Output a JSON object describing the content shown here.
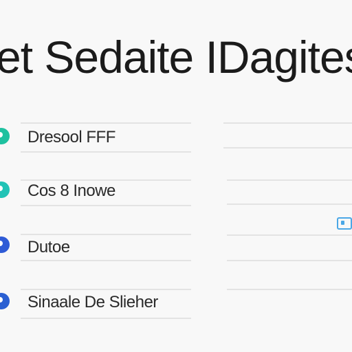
{
  "header": {
    "title": "et Sedaite IDagites"
  },
  "list": {
    "items": [
      {
        "label": "Dresool FFF",
        "dot_color": "#1fc1a0"
      },
      {
        "label": "Cos 8 Inowe",
        "dot_color": "#22c3b6"
      },
      {
        "label": "Dutoe",
        "dot_color": "#2f5bd6"
      },
      {
        "label": "Sinaale De Slieher",
        "dot_color": "#2a5fd2"
      }
    ]
  },
  "colors": {
    "accent_blue": "#4aa7e6",
    "divider": "#e3e3e3"
  },
  "icons": {
    "right_toggle": "toggle-switch-icon"
  }
}
